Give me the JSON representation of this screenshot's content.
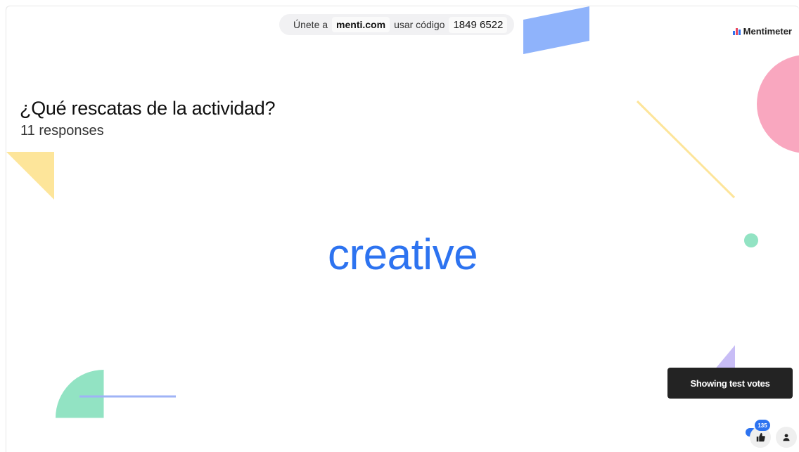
{
  "join_banner": {
    "prefix": "Únete a",
    "site": "menti.com",
    "middle": "usar código",
    "code": "1849 6522"
  },
  "logo": {
    "text": "Mentimeter",
    "colors": [
      "#2d73f0",
      "#e8475f",
      "#2d73f0"
    ]
  },
  "question": {
    "title": "¿Qué rescatas de la actividad?",
    "responses": "11 responses"
  },
  "wordcloud": {
    "words": [
      "creative"
    ],
    "color": "#2d73f0"
  },
  "toast": {
    "text": "Showing test votes"
  },
  "controls": {
    "reaction_icon": "thumbs-up-icon",
    "reaction_badge": "135",
    "user_icon": "user-icon"
  },
  "colors": {
    "accent": "#2d73f0",
    "pink": "#f9a7bf",
    "yellow": "#fde59a",
    "green": "#92e3c3",
    "blue_shape": "#8fb3fb",
    "purple": "#c8bdf6"
  }
}
